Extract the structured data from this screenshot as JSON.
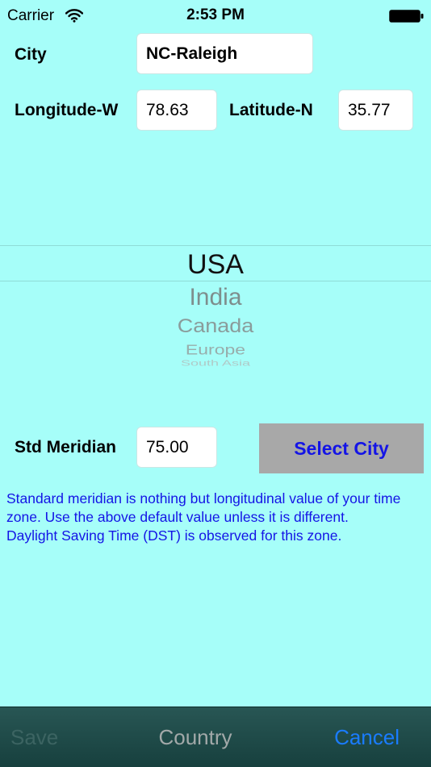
{
  "status_bar": {
    "carrier": "Carrier",
    "time": "2:53 PM"
  },
  "form": {
    "city_label": "City",
    "city_value": "NC-Raleigh",
    "longitude_label": "Longitude-W",
    "longitude_value": "78.63",
    "latitude_label": "Latitude-N",
    "latitude_value": "35.77",
    "meridian_label": "Std Meridian",
    "meridian_value": "75.00"
  },
  "picker": {
    "selected": "USA",
    "items": [
      "India",
      "Canada",
      "Europe",
      "South Asia"
    ]
  },
  "select_city_label": "Select City",
  "info": {
    "line1": "Standard meridian is nothing but longitudinal value of your time zone.  Use the above default value unless it is different.",
    "line2": "Daylight Saving Time (DST) is observed for this zone."
  },
  "toolbar": {
    "save_label": "Save",
    "country_label": "Country",
    "cancel_label": "Cancel"
  },
  "colors": {
    "background": "#a6fef9",
    "info_text": "#1414e6",
    "select_city_button": "#a8a8a8",
    "cancel": "#1a7cff"
  }
}
